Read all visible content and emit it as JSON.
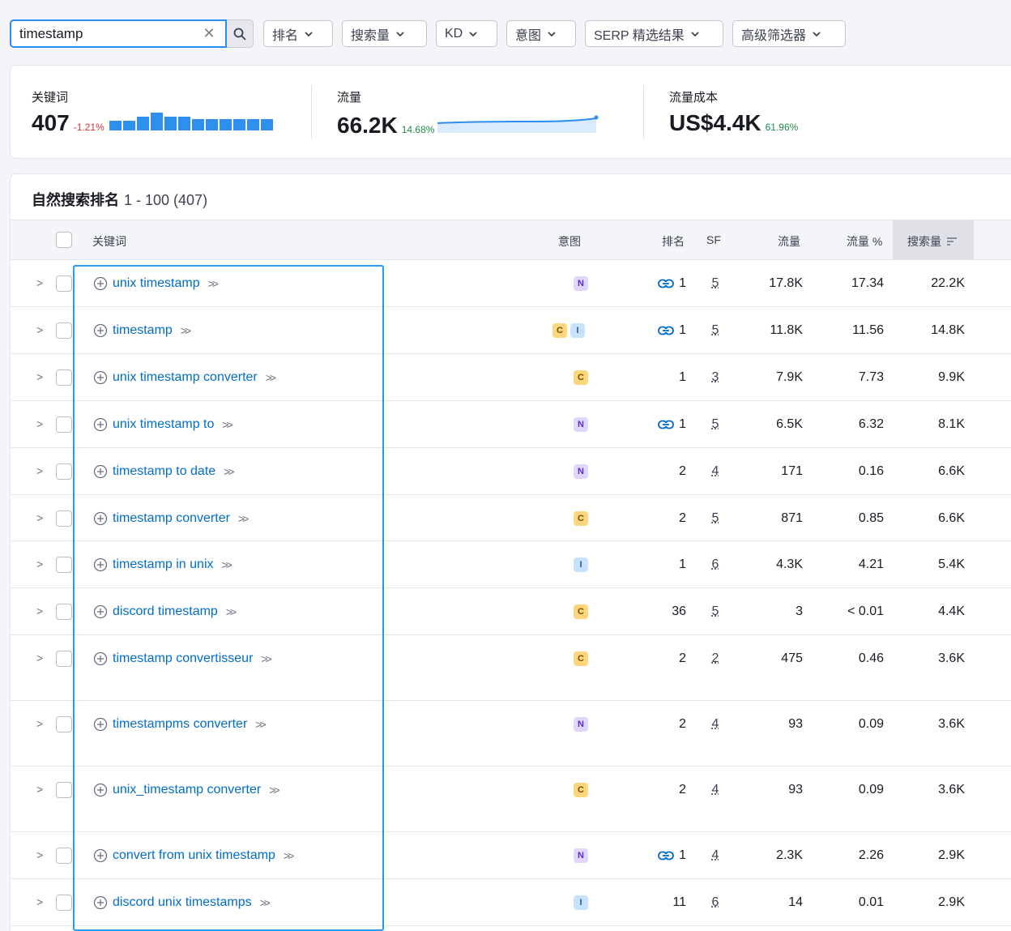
{
  "filters": {
    "search_value": "timestamp",
    "buttons": [
      "排名",
      "搜索量",
      "KD",
      "意图",
      "SERP 精选结果",
      "高级筛选器"
    ]
  },
  "summary": {
    "keywords": {
      "label": "关键词",
      "value": "407",
      "delta": "-1.21%"
    },
    "traffic": {
      "label": "流量",
      "value": "66.2K",
      "delta": "14.68%"
    },
    "traffic_cost": {
      "label": "流量成本",
      "value": "US$4.4K",
      "delta": "61.96%"
    },
    "colors": {
      "negative": "#d1333a",
      "positive": "#1b8c4a",
      "accent": "#2f8fef"
    }
  },
  "table": {
    "title": "自然搜索排名",
    "range": "1 - 100 (407)",
    "headers": {
      "keyword": "关键词",
      "intent": "意图",
      "position": "排名",
      "sf": "SF",
      "traffic": "流量",
      "traffic_pct": "流量 %",
      "volume": "搜索量"
    },
    "rows": [
      {
        "keyword": "unix timestamp",
        "intents": [
          "N"
        ],
        "link": true,
        "position": "1",
        "sf": "5",
        "traffic": "17.8K",
        "traffic_pct": "17.34",
        "volume": "22.2K"
      },
      {
        "keyword": "timestamp",
        "intents": [
          "C",
          "I"
        ],
        "link": true,
        "position": "1",
        "sf": "5",
        "traffic": "11.8K",
        "traffic_pct": "11.56",
        "volume": "14.8K"
      },
      {
        "keyword": "unix timestamp converter",
        "intents": [
          "C"
        ],
        "link": false,
        "position": "1",
        "sf": "3",
        "traffic": "7.9K",
        "traffic_pct": "7.73",
        "volume": "9.9K"
      },
      {
        "keyword": "unix timestamp to",
        "intents": [
          "N"
        ],
        "link": true,
        "position": "1",
        "sf": "5",
        "traffic": "6.5K",
        "traffic_pct": "6.32",
        "volume": "8.1K"
      },
      {
        "keyword": "timestamp to date",
        "intents": [
          "N"
        ],
        "link": false,
        "position": "2",
        "sf": "4",
        "traffic": "171",
        "traffic_pct": "0.16",
        "volume": "6.6K"
      },
      {
        "keyword": "timestamp converter",
        "intents": [
          "C"
        ],
        "link": false,
        "position": "2",
        "sf": "5",
        "traffic": "871",
        "traffic_pct": "0.85",
        "volume": "6.6K"
      },
      {
        "keyword": "timestamp in unix",
        "intents": [
          "I"
        ],
        "link": false,
        "position": "1",
        "sf": "6",
        "traffic": "4.3K",
        "traffic_pct": "4.21",
        "volume": "5.4K"
      },
      {
        "keyword": "discord timestamp",
        "intents": [
          "C"
        ],
        "link": false,
        "position": "36",
        "sf": "5",
        "traffic": "3",
        "traffic_pct": "< 0.01",
        "volume": "4.4K"
      },
      {
        "keyword": "timestamp convertisseur",
        "intents": [
          "C"
        ],
        "link": false,
        "position": "2",
        "sf": "2",
        "traffic": "475",
        "traffic_pct": "0.46",
        "volume": "3.6K"
      },
      {
        "keyword": "timestampms converter",
        "intents": [
          "N"
        ],
        "link": false,
        "position": "2",
        "sf": "4",
        "traffic": "93",
        "traffic_pct": "0.09",
        "volume": "3.6K"
      },
      {
        "keyword": "unix_timestamp converter",
        "intents": [
          "C"
        ],
        "link": false,
        "position": "2",
        "sf": "4",
        "traffic": "93",
        "traffic_pct": "0.09",
        "volume": "3.6K"
      },
      {
        "keyword": "convert from unix timestamp",
        "intents": [
          "N"
        ],
        "link": true,
        "position": "1",
        "sf": "4",
        "traffic": "2.3K",
        "traffic_pct": "2.26",
        "volume": "2.9K"
      },
      {
        "keyword": "discord unix timestamps",
        "intents": [
          "I"
        ],
        "link": false,
        "position": "11",
        "sf": "6",
        "traffic": "14",
        "traffic_pct": "0.01",
        "volume": "2.9K"
      }
    ]
  }
}
